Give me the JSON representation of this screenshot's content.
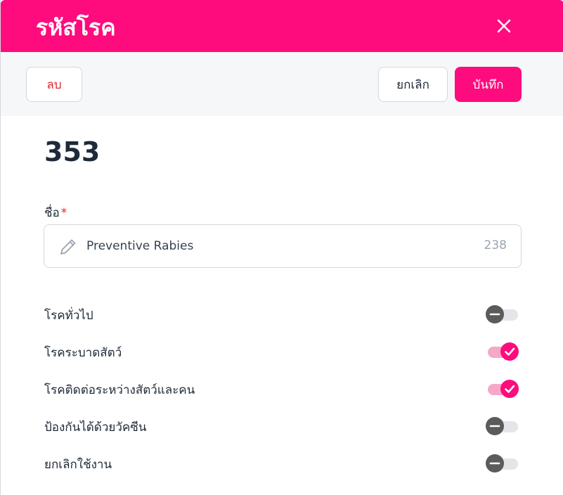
{
  "dialog": {
    "title": "รหัสโรค",
    "close_icon": "close-icon"
  },
  "toolbar": {
    "delete_label": "ลบ",
    "cancel_label": "ยกเลิก",
    "save_label": "บันทึก"
  },
  "record": {
    "id": "353"
  },
  "name_field": {
    "label": "ชื่อ",
    "required_mark": "*",
    "value": "Preventive Rabies",
    "char_count": "238",
    "icon": "pencil-icon"
  },
  "toggles": [
    {
      "label": "โรคทั่วไป",
      "checked": false
    },
    {
      "label": "โรคระบาดสัตว์",
      "checked": true
    },
    {
      "label": "โรคติดต่อระหว่างสัตว์และคน",
      "checked": true
    },
    {
      "label": "ป้องกันได้ด้วยวัคซีน",
      "checked": false
    },
    {
      "label": "ยกเลิกใช้งาน",
      "checked": false
    }
  ],
  "colors": {
    "accent": "#fe0b7d",
    "danger": "#e0262f",
    "toggle_off": "#5b5b5b"
  }
}
